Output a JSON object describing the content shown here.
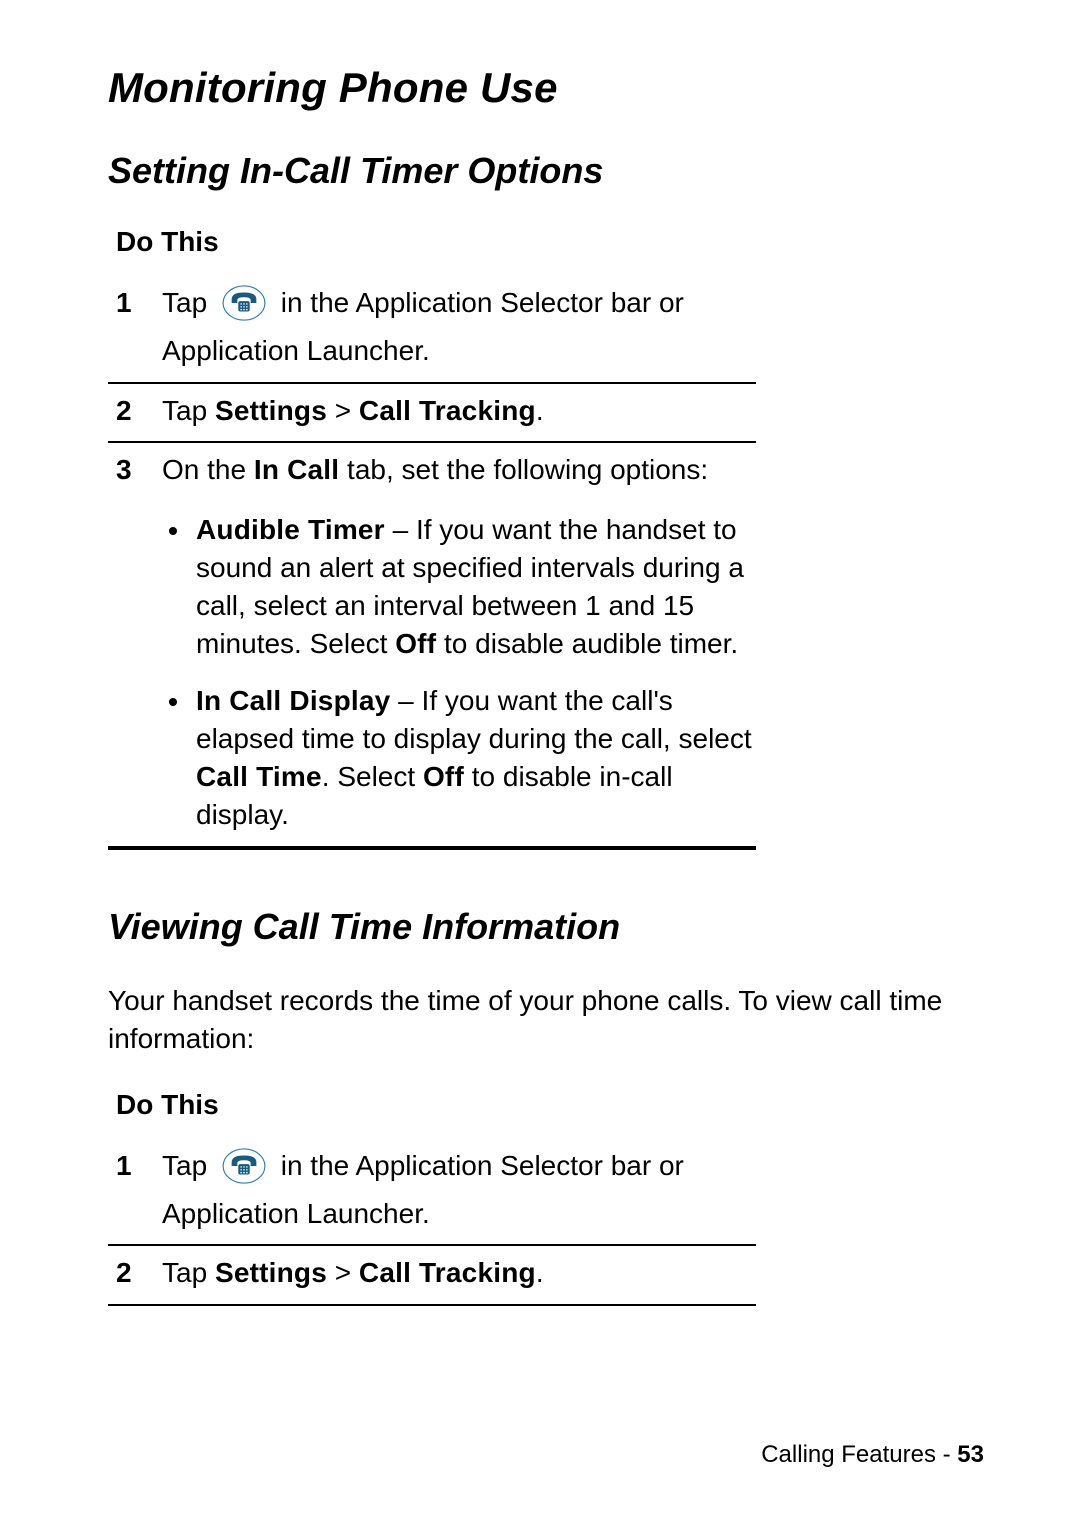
{
  "h1": "Monitoring Phone Use",
  "section1": {
    "h2": "Setting In-Call Timer Options",
    "doThis": "Do This",
    "steps": [
      {
        "num": "1",
        "prefix": "Tap ",
        "tail": " in the Application Selector bar or Application Launcher."
      },
      {
        "num": "2",
        "tap": "Tap ",
        "settings": "Settings",
        "gt": " > ",
        "calltracking": "Call Tracking",
        "period": "."
      },
      {
        "num": "3",
        "pre": "On the ",
        "incall": "In Call",
        "post": " tab, set the following options:",
        "bullets": [
          {
            "label": "Audible Timer",
            "dash": " – ",
            "body1": "If you want the handset to sound an alert at specified intervals during a call, select an interval between 1 and 15 minutes. Select ",
            "off": "Off",
            "body2": " to disable audible timer."
          },
          {
            "label": "In Call Display",
            "dash": " – ",
            "body1": "If you want the call's elapsed time to display during the call, select ",
            "calltime": "Call Time",
            "body2": ". Select ",
            "off": "Off",
            "body3": " to disable in-call display."
          }
        ]
      }
    ]
  },
  "section2": {
    "h2": "Viewing Call Time Information",
    "para": "Your handset records the time of your phone calls. To view call time information:",
    "doThis": "Do This",
    "steps": [
      {
        "num": "1",
        "prefix": "Tap ",
        "tail": " in the Application Selector bar or Application Launcher."
      },
      {
        "num": "2",
        "tap": "Tap ",
        "settings": "Settings",
        "gt": " > ",
        "calltracking": "Call Tracking",
        "period": "."
      }
    ]
  },
  "footer": {
    "section": "Calling Features - ",
    "page": "53"
  }
}
